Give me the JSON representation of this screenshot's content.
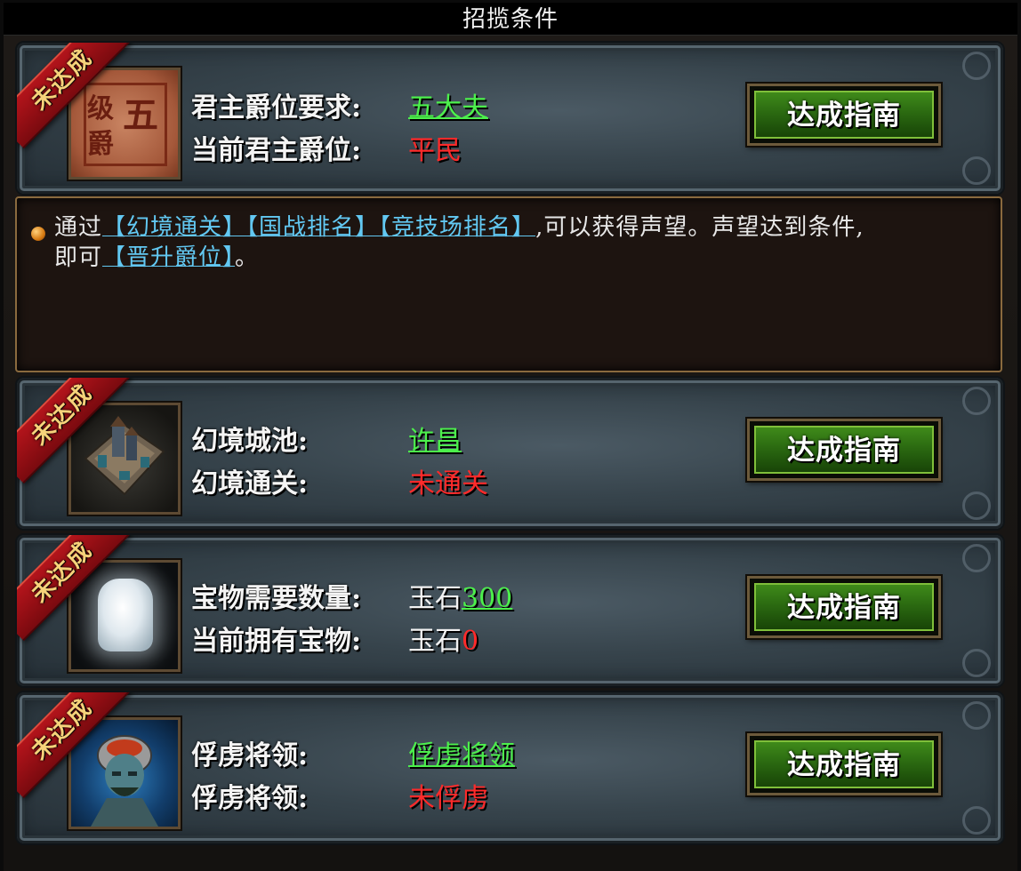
{
  "title": "招揽条件",
  "ribbon_text": "未达成",
  "button_label": "达成指南",
  "conditions": [
    {
      "icon": "rank-seal-icon",
      "icon_text": [
        "五",
        "级",
        "爵"
      ],
      "row1_label": "君主爵位要求:",
      "row1_value": "五大夫",
      "row2_label": "当前君主爵位:",
      "row2_value": "平民"
    },
    {
      "icon": "illusion-city-icon",
      "row1_label": "幻境城池:",
      "row1_value": "许昌",
      "row2_label": "幻境通关:",
      "row2_value": "未通关"
    },
    {
      "icon": "jade-stone-icon",
      "row1_label": "宝物需要数量:",
      "row1_value_prefix": "玉石",
      "row1_value": "300",
      "row2_label": "当前拥有宝物:",
      "row2_value_prefix": "玉石",
      "row2_value": "0"
    },
    {
      "icon": "captive-general-icon",
      "row1_label": "俘虏将领:",
      "row1_value": "俘虏将领",
      "row2_label": "俘虏将领:",
      "row2_value": "未俘虏"
    }
  ],
  "description": {
    "intro": "通过",
    "links": [
      "【幻境通关】",
      "【国战排名】",
      "【竞技场排名】",
      "【晋升爵位】"
    ],
    "middle": ",可以获得声望。声望达到条件,",
    "line2_prefix": "即可",
    "end": "。"
  },
  "colors": {
    "met": "#4cf04c",
    "unmet": "#ff2a2a",
    "link": "#62c8f2",
    "button": "#2b6a11"
  }
}
